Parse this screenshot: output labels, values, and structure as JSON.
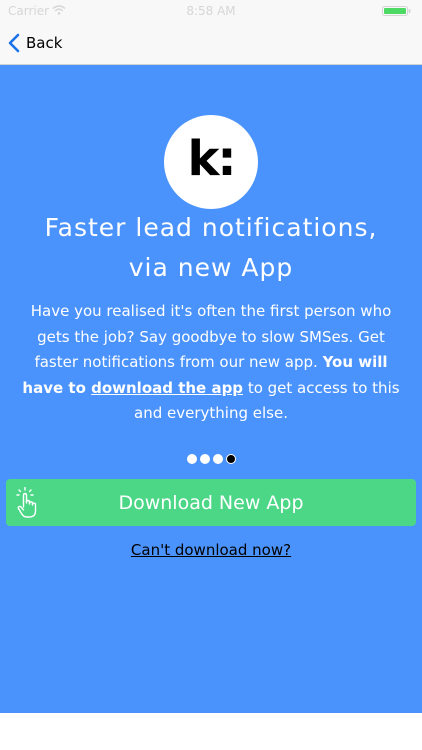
{
  "status_bar": {
    "carrier": "Carrier",
    "time": "8:58 AM",
    "battery_color": "#4cd964"
  },
  "nav": {
    "back_label": "Back",
    "accent_color": "#1a73e8"
  },
  "panel": {
    "background_color": "#4b93fc",
    "logo_text": "k:",
    "headline_line1": "Faster lead notifications,",
    "headline_line2": "via new App",
    "body": {
      "line1": "Have you realised it's often the first person who",
      "line2": "gets the job? Say goodbye to slow SMSes. Get",
      "line3_a": "faster notifications from our new app. ",
      "line3_b": "You will",
      "line4_a": "have to ",
      "line4_link": "download the app",
      "line4_b": " to get access to this",
      "line5": "and everything else."
    },
    "pagination": {
      "count": 4,
      "active_index": 3
    },
    "download_button": {
      "label": "Download New App",
      "icon": "pointing-hand-icon",
      "color": "#4cd787"
    },
    "secondary_link": "Can't download now?"
  }
}
